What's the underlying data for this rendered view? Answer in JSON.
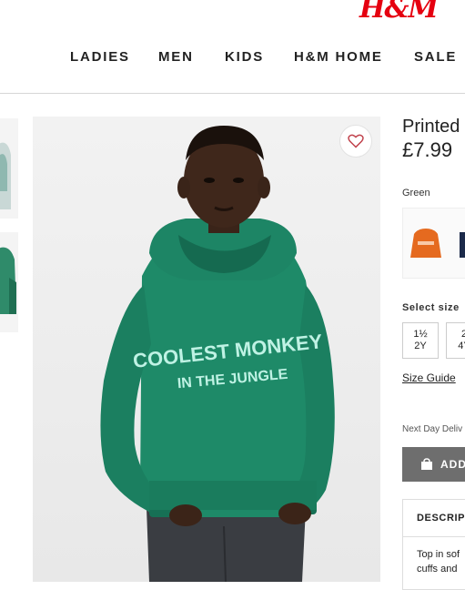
{
  "brand": {
    "logo_text": "H&M",
    "accent": "#e50010"
  },
  "nav": {
    "items": [
      "LADIES",
      "MEN",
      "KIDS",
      "H&M HOME",
      "SALE"
    ]
  },
  "product": {
    "title": "Printed",
    "price": "£7.99",
    "color_label": "Green",
    "hoodie_print_line1": "COOLEST MONKEY",
    "hoodie_print_line2": "IN THE JUNGLE",
    "size_label": "Select size",
    "sizes": [
      {
        "line1": "1½",
        "line2": "2Y"
      },
      {
        "line1": "2",
        "line2": "4Y"
      }
    ],
    "size_guide": "Size Guide",
    "delivery": "Next Day Deliv",
    "add_button": "ADD",
    "description_heading": "DESCRIPT",
    "description_text_line1": "Top in sof",
    "description_text_line2": "cuffs and"
  },
  "icons": {
    "favorite": "heart-icon",
    "bag": "bag-icon"
  }
}
